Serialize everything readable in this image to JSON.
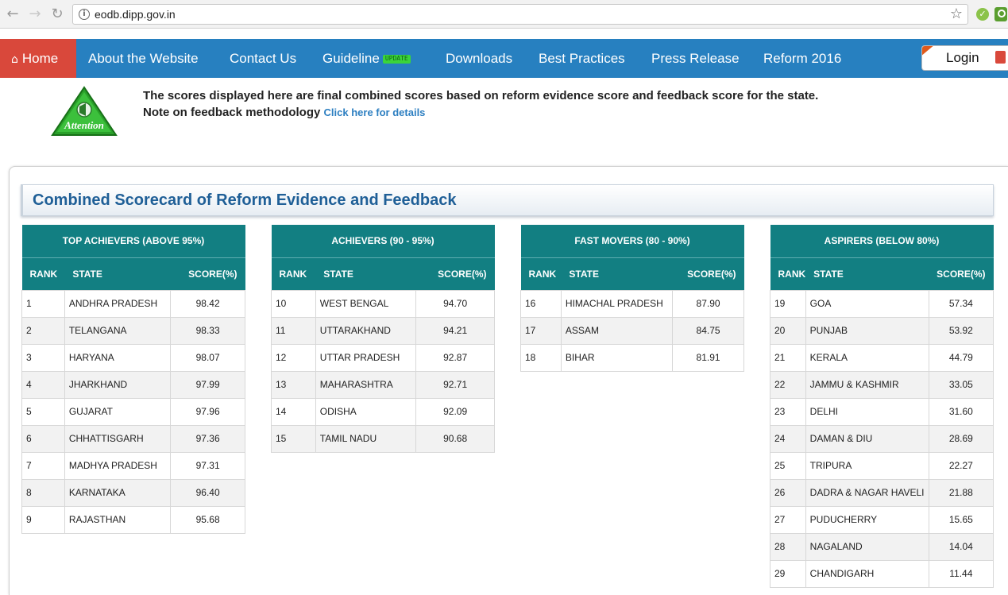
{
  "browser": {
    "url": "eodb.dipp.gov.in",
    "back_glyph": "←",
    "forward_glyph": "→",
    "reload_glyph": "↻",
    "star_glyph": "☆",
    "info_glyph": "i",
    "check_glyph": "✓"
  },
  "nav": {
    "home_glyph": "⌂",
    "home": "Home",
    "items": [
      "About the Website",
      "Contact Us",
      "Guideline",
      "Downloads",
      "Best Practices",
      "Press Release",
      "Reform 2016"
    ],
    "update_badge": "UPDATE",
    "login": "Login"
  },
  "notice": {
    "attention_label": "Attention",
    "line1": "The scores displayed here are final combined scores based on reform evidence score and feedback score for the state.",
    "line2": "Note on feedback methodology",
    "link": "Click here for details"
  },
  "panel": {
    "title": "Combined Scorecard of Reform Evidence and Feedback"
  },
  "tables": [
    {
      "title": "TOP ACHIEVERS (ABOVE 95%)",
      "headers": [
        "RANK",
        "STATE",
        "SCORE(%)"
      ],
      "rows": [
        [
          "1",
          "ANDHRA PRADESH",
          "98.42"
        ],
        [
          "2",
          "TELANGANA",
          "98.33"
        ],
        [
          "3",
          "HARYANA",
          "98.07"
        ],
        [
          "4",
          "JHARKHAND",
          "97.99"
        ],
        [
          "5",
          "GUJARAT",
          "97.96"
        ],
        [
          "6",
          "CHHATTISGARH",
          "97.36"
        ],
        [
          "7",
          "MADHYA PRADESH",
          "97.31"
        ],
        [
          "8",
          "KARNATAKA",
          "96.40"
        ],
        [
          "9",
          "RAJASTHAN",
          "95.68"
        ]
      ]
    },
    {
      "title": "ACHIEVERS (90 - 95%)",
      "headers": [
        "RANK",
        "STATE",
        "SCORE(%)"
      ],
      "rows": [
        [
          "10",
          "WEST BENGAL",
          "94.70"
        ],
        [
          "11",
          "UTTARAKHAND",
          "94.21"
        ],
        [
          "12",
          "UTTAR PRADESH",
          "92.87"
        ],
        [
          "13",
          "MAHARASHTRA",
          "92.71"
        ],
        [
          "14",
          "ODISHA",
          "92.09"
        ],
        [
          "15",
          "TAMIL NADU",
          "90.68"
        ]
      ]
    },
    {
      "title": "FAST MOVERS (80 - 90%)",
      "headers": [
        "RANK",
        "STATE",
        "SCORE(%)"
      ],
      "rows": [
        [
          "16",
          "HIMACHAL PRADESH",
          "87.90"
        ],
        [
          "17",
          "ASSAM",
          "84.75"
        ],
        [
          "18",
          "BIHAR",
          "81.91"
        ]
      ]
    },
    {
      "title": "ASPIRERS (BELOW 80%)",
      "headers": [
        "RANK",
        "STATE",
        "SCORE(%)"
      ],
      "rows": [
        [
          "19",
          "GOA",
          "57.34"
        ],
        [
          "20",
          "PUNJAB",
          "53.92"
        ],
        [
          "21",
          "KERALA",
          "44.79"
        ],
        [
          "22",
          "JAMMU & KASHMIR",
          "33.05"
        ],
        [
          "23",
          "DELHI",
          "31.60"
        ],
        [
          "24",
          "DAMAN & DIU",
          "28.69"
        ],
        [
          "25",
          "TRIPURA",
          "22.27"
        ],
        [
          "26",
          "DADRA & NAGAR HAVELI",
          "21.88"
        ],
        [
          "27",
          "PUDUCHERRY",
          "15.65"
        ],
        [
          "28",
          "NAGALAND",
          "14.04"
        ],
        [
          "29",
          "CHANDIGARH",
          "11.44"
        ]
      ]
    }
  ],
  "colors": {
    "nav_bg": "#2780c0",
    "home_bg": "#d9483b",
    "table_header": "#127f82",
    "title_text": "#1f5f97",
    "link": "#2d7fc1"
  }
}
